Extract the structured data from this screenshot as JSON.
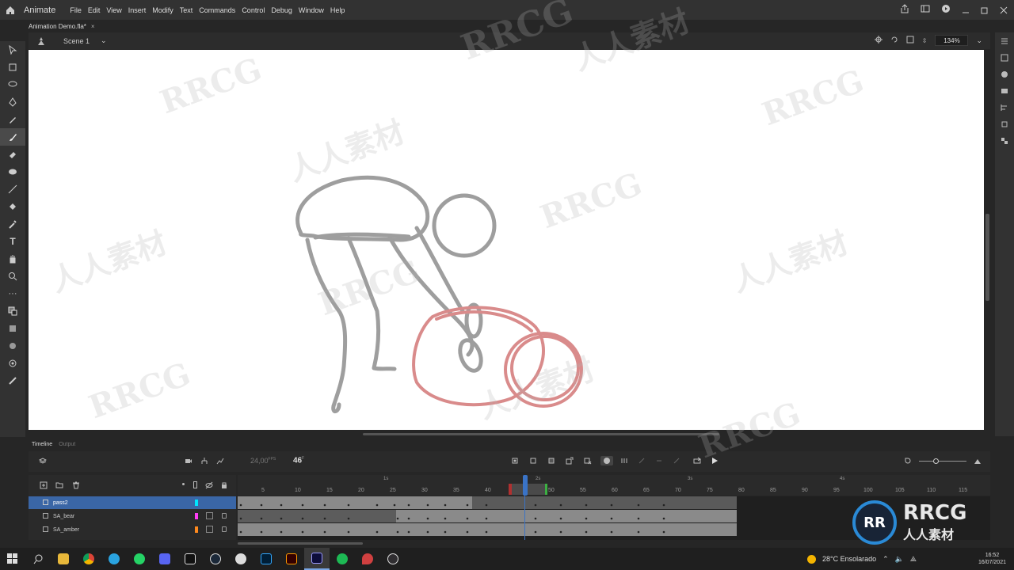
{
  "app": {
    "name": "Animate",
    "menus": [
      "File",
      "Edit",
      "View",
      "Insert",
      "Modify",
      "Text",
      "Commands",
      "Control",
      "Debug",
      "Window",
      "Help"
    ]
  },
  "document": {
    "tab_title": "Animation Demo.fla*",
    "tab_close": "×",
    "scene": "Scene 1",
    "zoom": "134%"
  },
  "timeline": {
    "panel_tabs": [
      "Timeline",
      "Output"
    ],
    "fps_value": "24,00",
    "fps_unit": "FPS",
    "current_frame": "46",
    "frame_unit": "F",
    "frame_ticks": [
      "5",
      "10",
      "15",
      "20",
      "25",
      "30",
      "35",
      "40",
      "45",
      "50",
      "55",
      "60",
      "65",
      "70",
      "75",
      "80",
      "85",
      "90",
      "95",
      "100",
      "105",
      "110",
      "115"
    ],
    "second_marks": [
      "1s",
      "2s",
      "3s",
      "4s"
    ],
    "layers": [
      {
        "name": "pass2",
        "color": "#00e5ff",
        "selected": true
      },
      {
        "name": "SA_bear",
        "color": "#ff3df5",
        "selected": false
      },
      {
        "name": "SA_amber",
        "color": "#ff8a1e",
        "selected": false
      }
    ]
  },
  "taskbar": {
    "weather": "28°C  Ensolarado",
    "time": "16:52",
    "date": "16/07/2021"
  },
  "watermarks": [
    "RRCG",
    "人人素材"
  ],
  "colors": {
    "accent": "#3a66a6",
    "sketch_gray": "#9e9e9e",
    "sketch_red": "#d98b8b"
  }
}
